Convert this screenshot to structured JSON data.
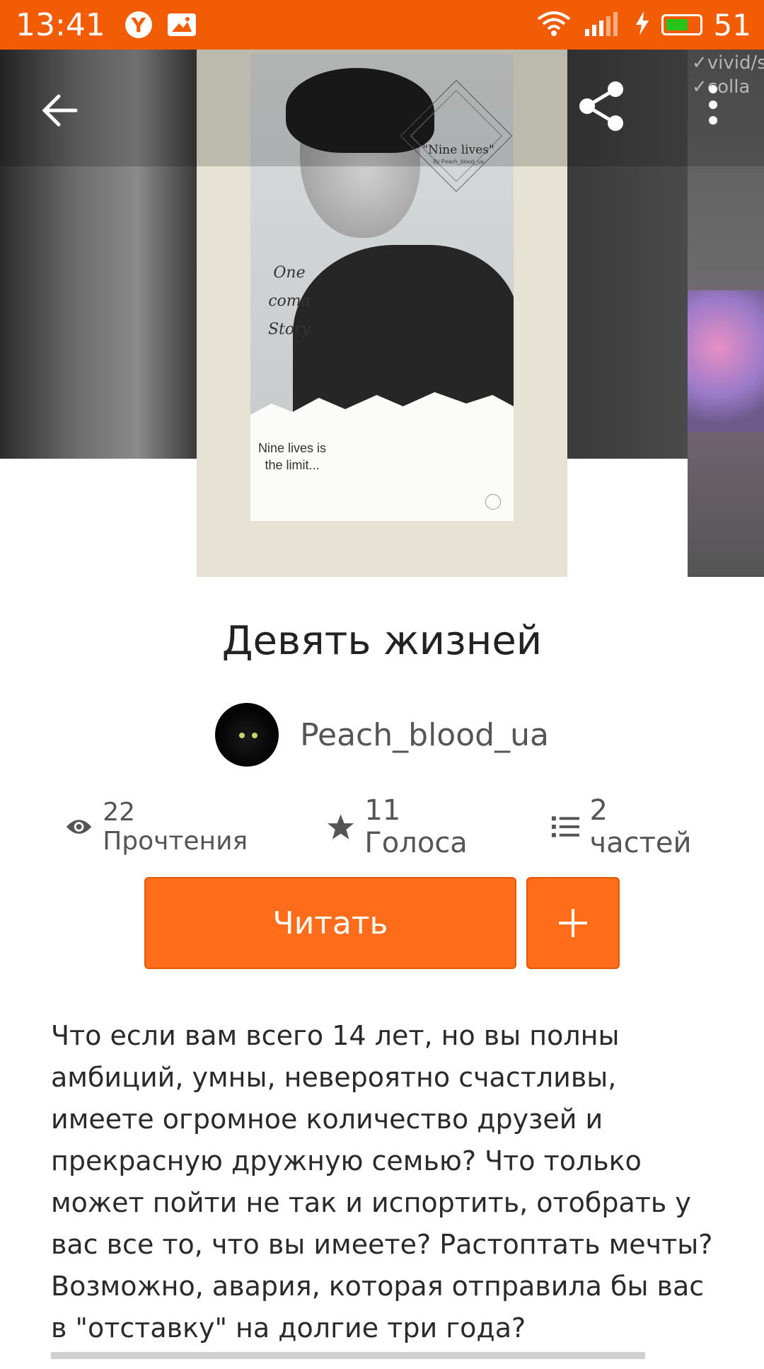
{
  "status_bar": {
    "time": "13:41",
    "battery_percent": "51",
    "icons": [
      "yandex-icon",
      "image-notification-icon",
      "wifi-icon",
      "signal-icon",
      "charging-icon",
      "battery-icon"
    ]
  },
  "toolbar": {
    "back_icon": "arrow-left-icon",
    "share_icon": "share-icon",
    "more_icon": "more-vertical-icon"
  },
  "cover": {
    "title_text": "\"Nine lives\"",
    "by_text": "By Peach_blood_ua",
    "script_text": "One coma Story",
    "tagline": "Nine lives is the limit..."
  },
  "next_cover_text": "✓vivid/sm ✓colla",
  "book": {
    "title": "Девять жизней",
    "author": "Peach_blood_ua"
  },
  "stats": {
    "reads": "22 Прочтения",
    "votes": "11 Голоса",
    "parts": "2 частей"
  },
  "actions": {
    "read_label": "Читать",
    "add_label": "+"
  },
  "description": "Что если вам всего 14 лет, но вы полны амбиций, умны, невероятно счастливы, имеете огромное количество друзей и прекрасную дружную семью? Что только может пойти не так и испортить, отобрать у вас все то, что вы имеете? Растоптать мечты? Возможно, авария, которая отправила бы вас в \"отставку\" на долгие три года?",
  "colors": {
    "status_bar": "#f25c05",
    "accent": "#ff6d1a"
  }
}
